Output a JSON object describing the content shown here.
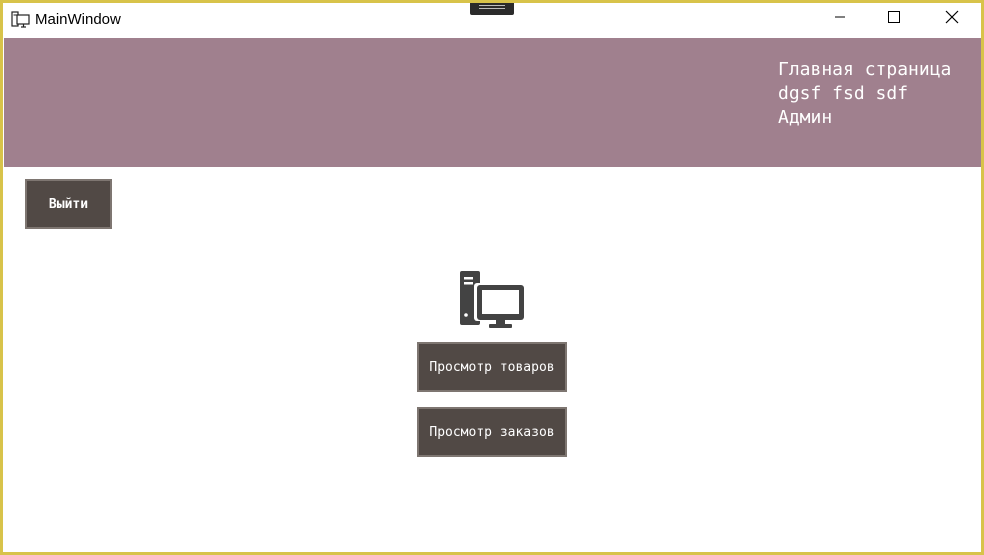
{
  "window": {
    "title": "MainWindow",
    "app_icon": "app-window-icon"
  },
  "window_controls": {
    "minimize_icon": "minimize-icon",
    "maximize_icon": "maximize-icon",
    "close_icon": "close-icon"
  },
  "header": {
    "page_title": "Главная страница",
    "user_name": "dgsf fsd sdf",
    "user_role": "Админ",
    "background_color": "#a0808e"
  },
  "actions": {
    "exit_label": "Выйти",
    "view_products_label": "Просмотр товаров",
    "view_orders_label": "Просмотр заказов",
    "button_color": "#514945"
  },
  "main": {
    "icon": "computer-icon"
  }
}
